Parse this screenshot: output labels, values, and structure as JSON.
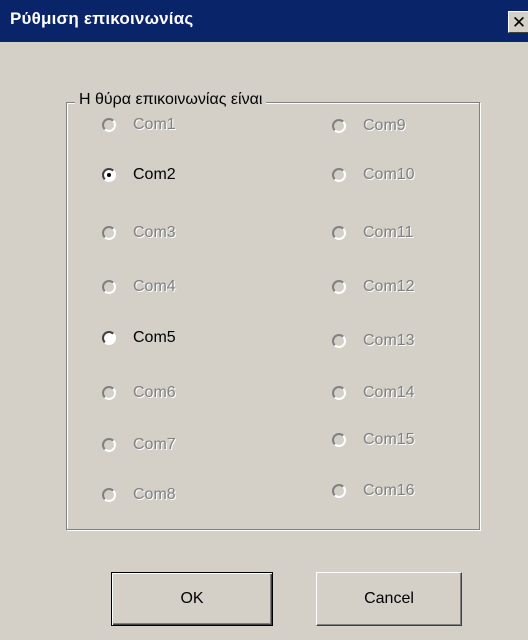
{
  "window": {
    "title": "Ρύθμιση επικοινωνίας",
    "close_glyph": "✕"
  },
  "group": {
    "label": "Η θύρα επικοινωνίας είναι"
  },
  "ports": [
    {
      "label": "Com1",
      "enabled": false,
      "checked": false
    },
    {
      "label": "Com2",
      "enabled": true,
      "checked": true
    },
    {
      "label": "Com3",
      "enabled": false,
      "checked": false
    },
    {
      "label": "Com4",
      "enabled": false,
      "checked": false
    },
    {
      "label": "Com5",
      "enabled": true,
      "checked": false
    },
    {
      "label": "Com6",
      "enabled": false,
      "checked": false
    },
    {
      "label": "Com7",
      "enabled": false,
      "checked": false
    },
    {
      "label": "Com8",
      "enabled": false,
      "checked": false
    },
    {
      "label": "Com9",
      "enabled": false,
      "checked": false
    },
    {
      "label": "Com10",
      "enabled": false,
      "checked": false
    },
    {
      "label": "Com11",
      "enabled": false,
      "checked": false
    },
    {
      "label": "Com12",
      "enabled": false,
      "checked": false
    },
    {
      "label": "Com13",
      "enabled": false,
      "checked": false
    },
    {
      "label": "Com14",
      "enabled": false,
      "checked": false
    },
    {
      "label": "Com15",
      "enabled": false,
      "checked": false
    },
    {
      "label": "Com16",
      "enabled": false,
      "checked": false
    }
  ],
  "buttons": {
    "ok_label": "OK",
    "cancel_label": "Cancel"
  },
  "colors": {
    "titlebar": "#0a246a",
    "face": "#d4d0c8",
    "disabled_text": "#808080"
  }
}
